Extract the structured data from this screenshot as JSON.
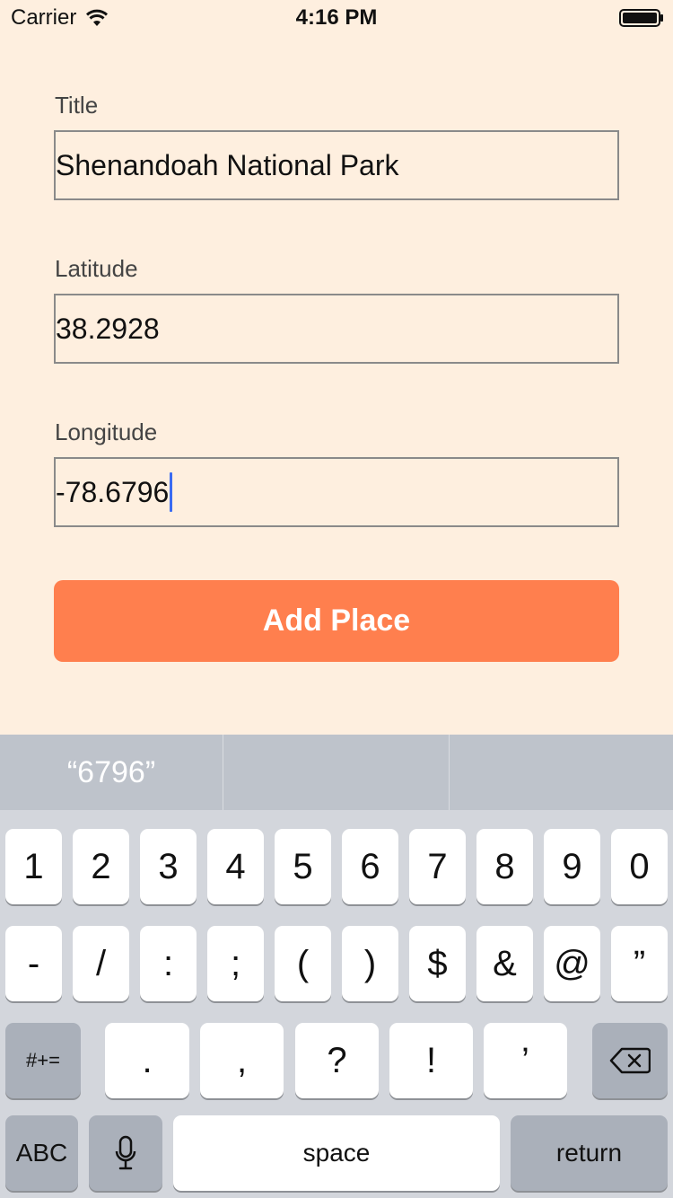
{
  "status_bar": {
    "carrier": "Carrier",
    "time": "4:16 PM"
  },
  "form": {
    "title_label": "Title",
    "title_value": "Shenandoah National Park",
    "latitude_label": "Latitude",
    "latitude_value": "38.2928",
    "longitude_label": "Longitude",
    "longitude_value": "-78.6796",
    "add_button_label": "Add Place"
  },
  "keyboard": {
    "suggestions": [
      "“6796”",
      "",
      ""
    ],
    "row1": [
      "1",
      "2",
      "3",
      "4",
      "5",
      "6",
      "7",
      "8",
      "9",
      "0"
    ],
    "row2": [
      "-",
      "/",
      ":",
      ";",
      "(",
      ")",
      "$",
      "&",
      "@",
      "”"
    ],
    "row3": {
      "switch_label": "#+=",
      "keys": [
        ".",
        ",",
        "?",
        "!",
        "’"
      ],
      "delete_icon": "backspace-icon"
    },
    "row4": {
      "abc_label": "ABC",
      "mic_icon": "microphone-icon",
      "space_label": "space",
      "return_label": "return"
    }
  }
}
